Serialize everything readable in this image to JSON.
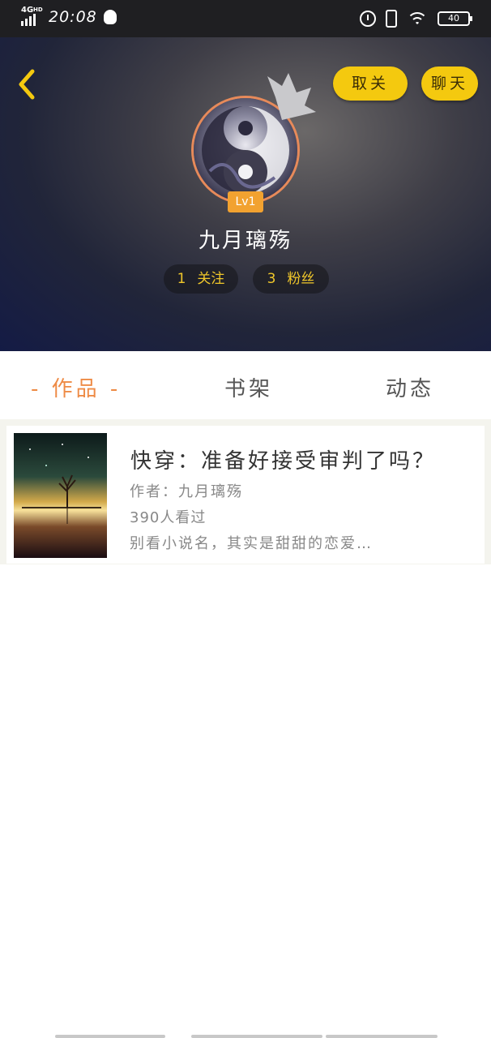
{
  "status_bar": {
    "network": "4G",
    "network_sub": "HD",
    "time": "20:08",
    "battery": "40"
  },
  "header": {
    "unfollow_label": "取关",
    "chat_label": "聊天",
    "level": "Lv1",
    "username": "九月璃殇",
    "following_count": "1",
    "following_label": "关注",
    "followers_count": "3",
    "followers_label": "粉丝"
  },
  "tabs": [
    {
      "label": "- 作品 -",
      "active": true
    },
    {
      "label": "书架",
      "active": false
    },
    {
      "label": "动态",
      "active": false
    }
  ],
  "works": [
    {
      "title": "快穿：准备好接受审判了吗？",
      "author": "作者：九月璃殇",
      "views": "390人看过",
      "summary": "别看小说名，其实是甜甜的恋爱…"
    }
  ],
  "colors": {
    "accent_yellow": "#f4c90f",
    "accent_orange": "#ee8b46",
    "level_badge": "#f2a230"
  },
  "icons": {
    "back": "chevron-left-icon",
    "crown": "crown-icon",
    "alarm": "alarm-icon",
    "vibrate": "vibrate-icon",
    "wifi": "wifi-icon",
    "battery": "battery-icon",
    "qq": "qq-icon"
  }
}
